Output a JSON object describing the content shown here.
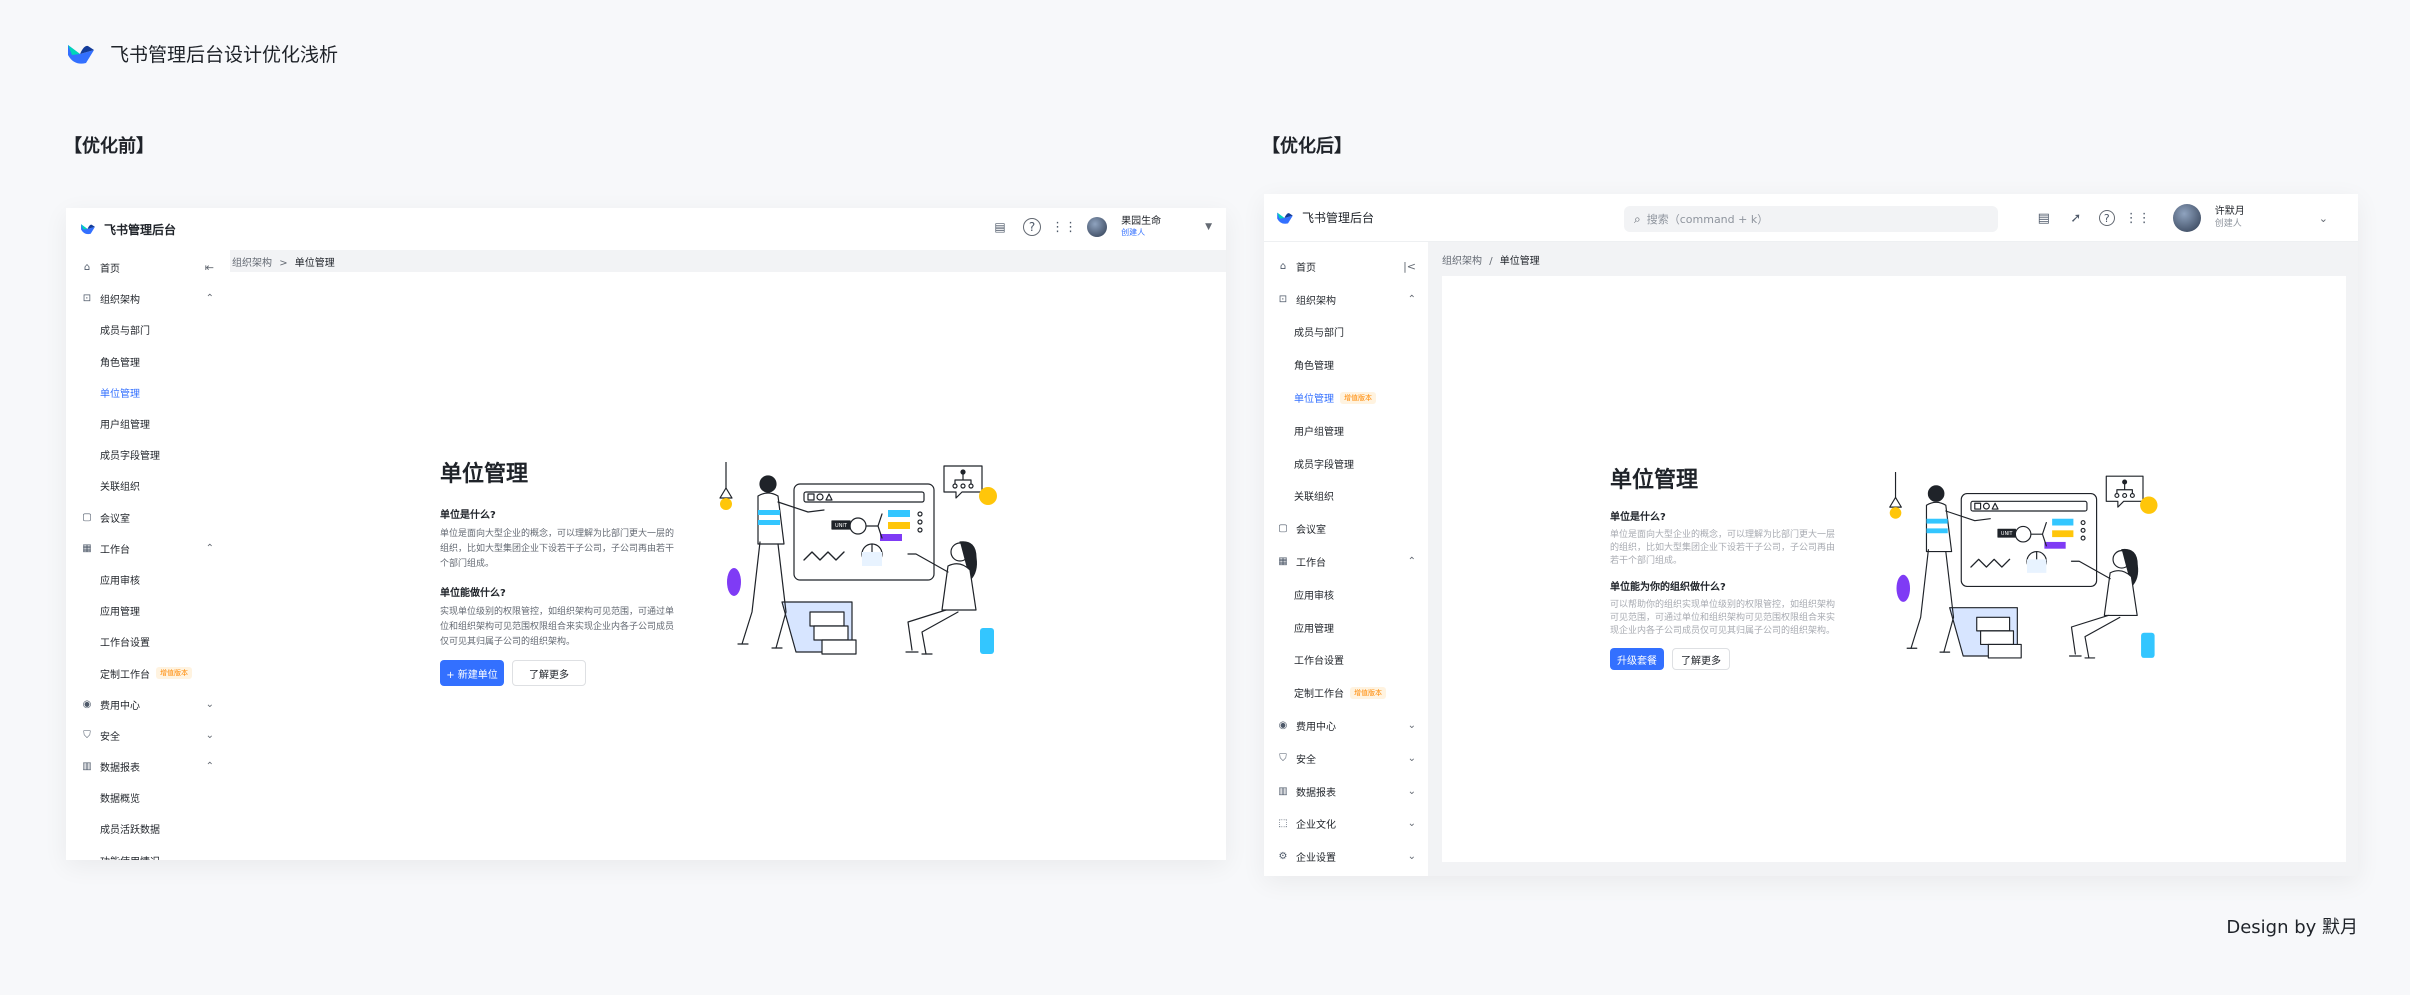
{
  "page": {
    "title": "飞书管理后台设计优化浅析",
    "before_label": "【优化前】",
    "after_label": "【优化后】",
    "credit": "Design by 默月"
  },
  "before": {
    "app_name": "飞书管理后台",
    "user": {
      "name": "果园生命",
      "role": "创建人"
    },
    "breadcrumb": {
      "parent": "组织架构",
      "sep": ">",
      "current": "单位管理"
    },
    "nav": [
      {
        "label": "首页",
        "icon": "home-icon"
      },
      {
        "label": "组织架构",
        "icon": "org-icon",
        "chev": "up"
      },
      {
        "label": "成员与部门",
        "sub": true
      },
      {
        "label": "角色管理",
        "sub": true
      },
      {
        "label": "单位管理",
        "sub": true,
        "active": true
      },
      {
        "label": "用户组管理",
        "sub": true
      },
      {
        "label": "成员字段管理",
        "sub": true
      },
      {
        "label": "关联组织",
        "sub": true
      },
      {
        "label": "会议室",
        "icon": "meeting-room-icon"
      },
      {
        "label": "工作台",
        "icon": "workspace-icon",
        "chev": "up"
      },
      {
        "label": "应用审核",
        "sub": true
      },
      {
        "label": "应用管理",
        "sub": true
      },
      {
        "label": "工作台设置",
        "sub": true
      },
      {
        "label": "定制工作台",
        "sub": true,
        "badge": "增值版本"
      },
      {
        "label": "费用中心",
        "icon": "billing-icon",
        "chev": "down"
      },
      {
        "label": "安全",
        "icon": "shield-icon",
        "chev": "down"
      },
      {
        "label": "数据报表",
        "icon": "report-icon",
        "chev": "up"
      },
      {
        "label": "数据概览",
        "sub": true
      },
      {
        "label": "成员活跃数据",
        "sub": true
      },
      {
        "label": "功能使用情况",
        "sub": true,
        "chev": "down"
      }
    ],
    "hero": {
      "title": "单位管理",
      "q1": "单位是什么?",
      "a1": "单位是面向大型企业的概念，可以理解为比部门更大一层的组织，比如大型集团企业下设若干子公司，子公司再由若干个部门组成。",
      "q2": "单位能做什么?",
      "a2": "实现单位级别的权限管控，如组织架构可见范围，可通过单位和组织架构可见范围权限组合来实现企业内各子公司成员仅可见其归属子公司的组织架构。",
      "primary": "+ 新建单位",
      "secondary": "了解更多"
    }
  },
  "after": {
    "app_name": "飞书管理后台",
    "search_placeholder": "搜索（command + k）",
    "user": {
      "name": "许默月",
      "role": "创建人"
    },
    "breadcrumb": {
      "parent": "组织架构",
      "sep": "/",
      "current": "单位管理"
    },
    "nav": [
      {
        "label": "首页",
        "icon": "home-icon"
      },
      {
        "label": "组织架构",
        "icon": "org-icon",
        "chev": "up"
      },
      {
        "label": "成员与部门",
        "sub": true
      },
      {
        "label": "角色管理",
        "sub": true
      },
      {
        "label": "单位管理",
        "sub": true,
        "active": true,
        "badge": "增值版本"
      },
      {
        "label": "用户组管理",
        "sub": true
      },
      {
        "label": "成员字段管理",
        "sub": true
      },
      {
        "label": "关联组织",
        "sub": true
      },
      {
        "label": "会议室",
        "icon": "meeting-room-icon"
      },
      {
        "label": "工作台",
        "icon": "workspace-icon",
        "chev": "up"
      },
      {
        "label": "应用审核",
        "sub": true
      },
      {
        "label": "应用管理",
        "sub": true
      },
      {
        "label": "工作台设置",
        "sub": true
      },
      {
        "label": "定制工作台",
        "sub": true,
        "badge": "增值版本"
      },
      {
        "label": "费用中心",
        "icon": "billing-icon",
        "chev": "down"
      },
      {
        "label": "安全",
        "icon": "shield-icon",
        "chev": "down"
      },
      {
        "label": "数据报表",
        "icon": "report-icon",
        "chev": "down"
      },
      {
        "label": "企业文化",
        "icon": "culture-icon",
        "chev": "down"
      },
      {
        "label": "企业设置",
        "icon": "settings-icon",
        "chev": "down"
      }
    ],
    "hero": {
      "title": "单位管理",
      "q1": "单位是什么?",
      "a1": "单位是面向大型企业的概念，可以理解为比部门更大一层的组织，比如大型集团企业下设若干子公司，子公司再由若干个部门组成。",
      "q2": "单位能为你的组织做什么?",
      "a2": "可以帮助你的组织实现单位级别的权限管控，如组织架构可见范围，可通过单位和组织架构可见范围权限组合来实现企业内各子公司成员仅可见其归属子公司的组织架构。",
      "primary": "升级套餐",
      "secondary": "了解更多"
    }
  },
  "illustration": {
    "unit_tag": "UNIT"
  }
}
